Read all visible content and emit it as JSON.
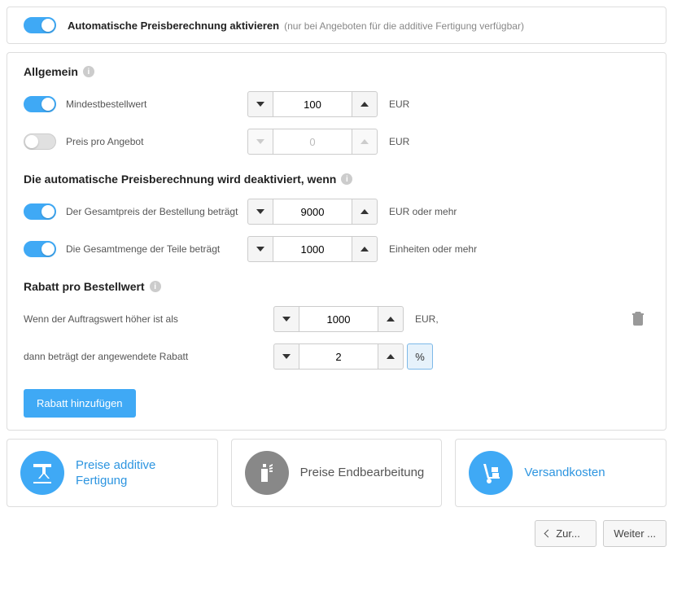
{
  "top": {
    "title": "Automatische Preisberechnung aktivieren",
    "hint": "(nur bei Angeboten für die additive Fertigung verfügbar)",
    "enabled": true
  },
  "general": {
    "heading": "Allgemein",
    "minOrder": {
      "label": "Mindestbestellwert",
      "value": "100",
      "unit": "EUR",
      "enabled": true
    },
    "pricePerOffer": {
      "label": "Preis pro Angebot",
      "value": "0",
      "unit": "EUR",
      "enabled": false
    }
  },
  "deactivate": {
    "heading": "Die automatische Preisberechnung wird deaktiviert, wenn",
    "totalPrice": {
      "label": "Der Gesamtpreis der Bestellung beträgt",
      "value": "9000",
      "unit": "EUR oder mehr",
      "enabled": true
    },
    "totalQty": {
      "label": "Die Gesamtmenge der Teile beträgt",
      "value": "1000",
      "unit": "Einheiten oder mehr",
      "enabled": true
    }
  },
  "discount": {
    "heading": "Rabatt pro Bestellwert",
    "thresholdLabel": "Wenn der Auftragswert höher ist als",
    "thresholdValue": "1000",
    "thresholdUnit": "EUR,",
    "rateLabel": "dann beträgt der angewendete Rabatt",
    "rateValue": "2",
    "rateUnit": "%",
    "addButton": "Rabatt hinzufügen"
  },
  "cards": {
    "additive": "Preise additive Fertigung",
    "finishing": "Preise Endbearbeitung",
    "shipping": "Versandkosten"
  },
  "footer": {
    "back": "Zur...",
    "next": "Weiter ..."
  }
}
